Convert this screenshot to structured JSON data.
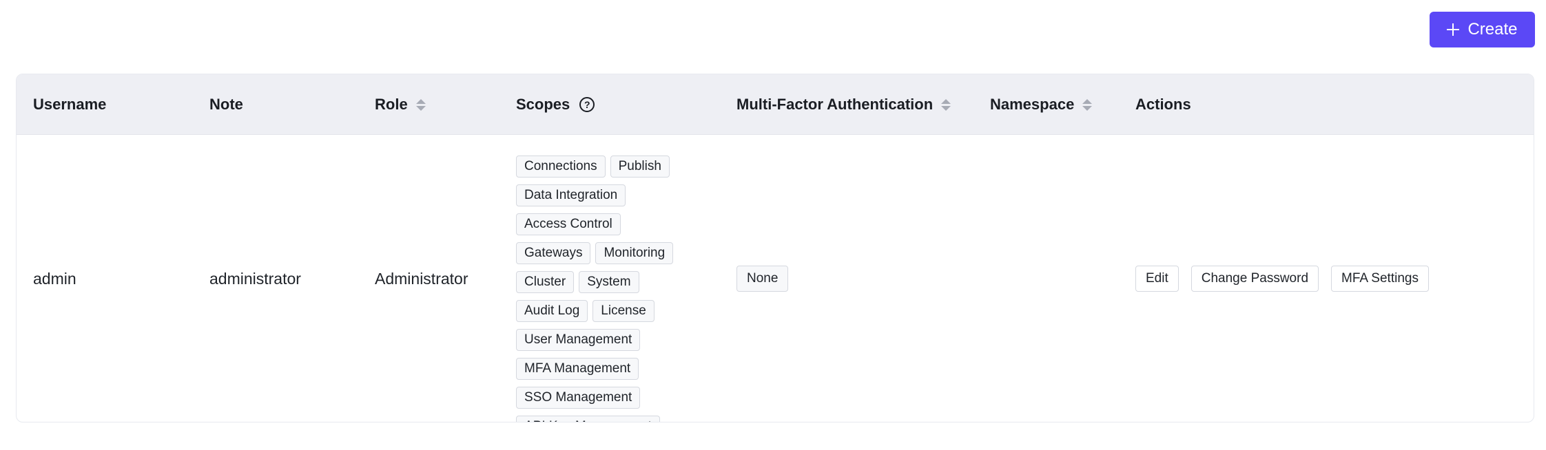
{
  "toolbar": {
    "create_label": "Create"
  },
  "table": {
    "columns": {
      "username": "Username",
      "note": "Note",
      "role": "Role",
      "scopes": "Scopes",
      "mfa": "Multi-Factor Authentication",
      "namespace": "Namespace",
      "actions": "Actions"
    },
    "rows": [
      {
        "username": "admin",
        "note": "administrator",
        "role": "Administrator",
        "scopes": [
          "Connections",
          "Publish",
          "Data Integration",
          "Access Control",
          "Gateways",
          "Monitoring",
          "Cluster",
          "System",
          "Audit Log",
          "License",
          "User Management",
          "MFA Management",
          "SSO Management",
          "API Key Management"
        ],
        "mfa": "None",
        "namespace": "",
        "actions": {
          "edit": "Edit",
          "change_password": "Change Password",
          "mfa_settings": "MFA Settings"
        }
      }
    ]
  },
  "colors": {
    "accent": "#5b48f6",
    "header_bg": "#eeeff4",
    "tag_border": "#d5d8df"
  },
  "icons": {
    "create": "plus-icon",
    "sort": "sort-icon",
    "help": "question-circle-icon"
  }
}
